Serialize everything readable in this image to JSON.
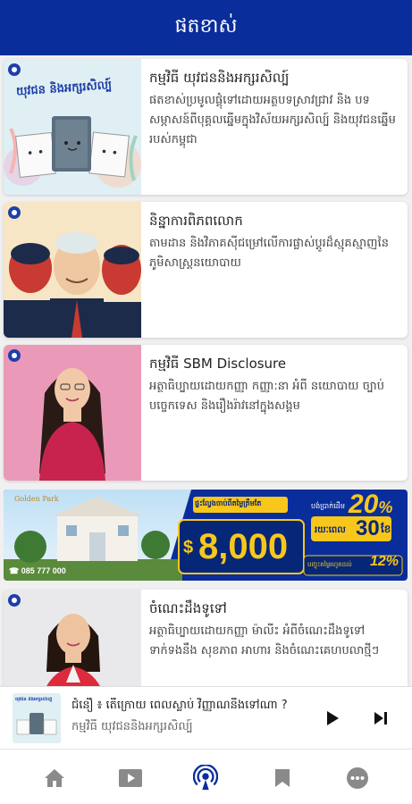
{
  "header": {
    "title": "ផតខាស់"
  },
  "feed": {
    "items": [
      {
        "title": "កម្មវិធី យុវជននិងអក្សរសិល្ប៍",
        "description": "ផតខាស់ប្រមូលផ្តុំទៅដោយអត្ថបទស្រាវជ្រាវ និង បទសម្ភាសន៍ពីបុគ្គលឆ្នើមក្នុងវិស័យអក្សរសិល្ប៍ និងយុវជនឆ្នើមរបស់កម្ពុជា",
        "thumb_text": "យុវជន និងអក្សរសិល្ប៍"
      },
      {
        "title": "និន្នាការពិភពលោក",
        "description": "តាមដាន និងវិភាគស៊ីជម្រៅលើការផ្លាស់ប្តូរដ៏ស្មុគស្មាញនៃភូមិសាស្ត្រនយោបាយ"
      },
      {
        "title": "កម្មវិធី SBM Disclosure",
        "description": "អត្ថាធិប្បាយដោយកញ្ញា កញ្ញា:នា អំពី នយោបាយ ច្បាប់ បច្ចេកទេស និងរឿងរ៉ាវនៅក្នុងសង្គម"
      },
      {
        "title": "ចំណេះដឹងទូទៅ",
        "description": "អត្ថាធិប្បាយដោយកញ្ញា ម៉ាលីះ អំពីចំណេះដឹងទូទៅ ទាក់ទងនឹង សុខភាព អាហារ និងចំណេះគេហបលាថ្មីៗ"
      }
    ]
  },
  "ad_banner": {
    "brand": "Golden Park",
    "phone": "☎ 085 777 000",
    "price_currency": "$",
    "price": "8,000",
    "percent_top": "20",
    "percent_sign": "%",
    "months": "30",
    "months_unit": "ខែ",
    "percent_bottom": "12%",
    "headline": "ផ្ទះល្វែងចាប់ពីតម្លៃត្រឹមតែ",
    "months_prefix": "រយៈពេល",
    "small_note": "បង់ប្រាក់ដើម",
    "bottom_note": "បញ្ចុះតម្លៃរហូតដល់"
  },
  "mini_player": {
    "episode_title": "ជំនឿ ៖ តើក្រោយ ពេលស្លាប់ វិញ្ញាណនឹងទៅណា ?",
    "program_name": "កម្មវិធី យុវជននិងអក្សរសិល្ប៍",
    "thumb_text": "យុវជន និងអក្សរសិល្ប៍"
  },
  "bottom_nav": {
    "items": [
      "home-icon",
      "video-icon",
      "podcast-icon",
      "bookmark-icon",
      "more-icon"
    ],
    "active_color": "#0a2d9c",
    "inactive_color": "#8a8a8a"
  },
  "colors": {
    "primary": "#0a2d9c",
    "accent_yellow": "#f8c71b"
  }
}
